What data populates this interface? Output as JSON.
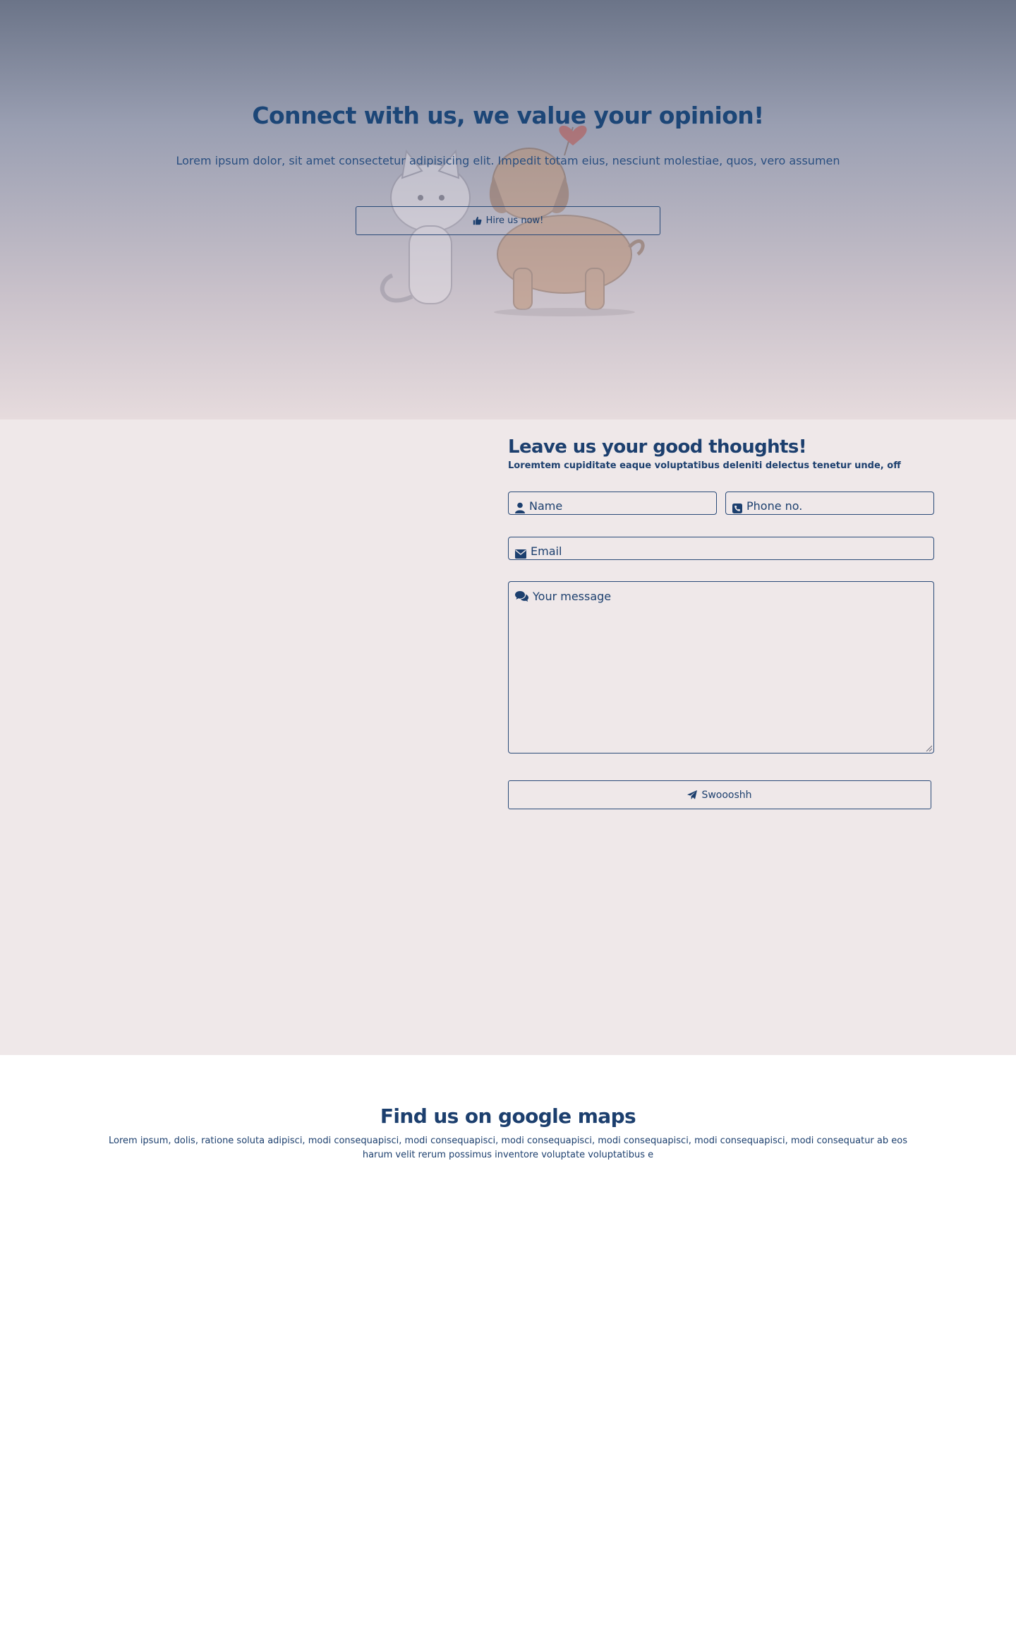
{
  "hero": {
    "title": "Connect with us, we value your opinion!",
    "subtitle": "Lorem ipsum dolor, sit amet consectetur adipisicing elit. Impedit totam eius, nesciunt molestiae, quos, vero assumen",
    "hire_button": {
      "label": "Hire us now!",
      "icon": "thumbs-up-icon"
    },
    "illustration": "cat-and-dog-with-heart-balloon"
  },
  "contact_form": {
    "title": "Leave us your good thoughts!",
    "subtitle": "Loremtem cupiditate eaque voluptatibus deleniti delectus tenetur unde, off",
    "fields": {
      "name": {
        "placeholder": "Name",
        "icon": "user-icon"
      },
      "phone": {
        "placeholder": "Phone no.",
        "icon": "phone-icon"
      },
      "email": {
        "placeholder": "Email",
        "icon": "envelope-icon"
      },
      "message": {
        "placeholder": "Your message",
        "icon": "comments-icon"
      }
    },
    "submit_button": {
      "label": "Swoooshh",
      "icon": "paper-plane-icon"
    }
  },
  "maps": {
    "title": "Find us on google maps",
    "subtitle": "Lorem ipsum, dolis, ratione soluta adipisci, modi consequapisci, modi consequapisci, modi consequapisci, modi consequapisci, modi consequapisci, modi consequatur ab eos harum velit rerum possimus inventore voluptate voluptatibus e"
  },
  "colors": {
    "primary_text": "#1c3f6e",
    "form_background": "#efe8e9",
    "hero_top": "#6b7488",
    "hero_bottom": "#e6dbdd"
  }
}
